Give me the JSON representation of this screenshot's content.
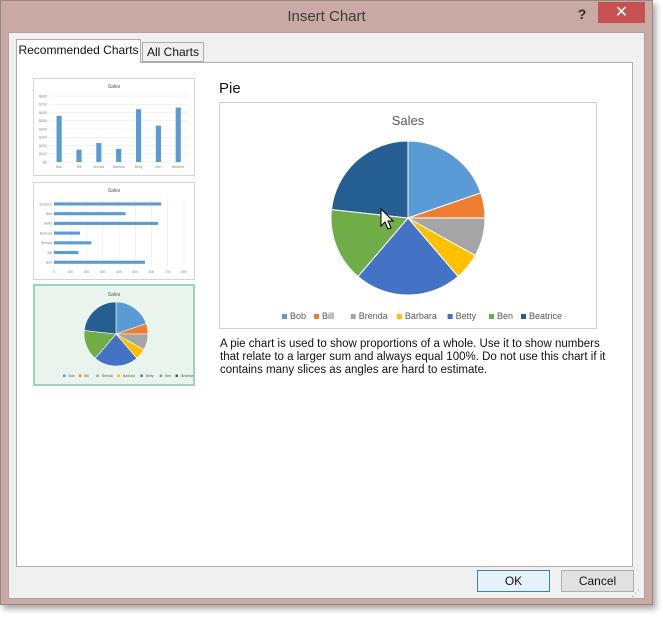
{
  "window": {
    "title": "Insert Chart",
    "help_label": "?",
    "close_label": "✕"
  },
  "tabs": [
    {
      "label": "Recommended Charts",
      "active": true
    },
    {
      "label": "All Charts",
      "active": false
    }
  ],
  "thumbnails": [
    {
      "kind": "column",
      "title": "Sales",
      "selected": false
    },
    {
      "kind": "bar",
      "title": "Sales",
      "selected": false
    },
    {
      "kind": "pie",
      "title": "Sales",
      "selected": true
    }
  ],
  "selected_chart": {
    "heading": "Pie",
    "description": "A pie chart is used to show proportions of a whole. Use it to show numbers that relate to a larger sum and always equal 100%. Do not use this chart if it contains many slices as angles are hard to estimate."
  },
  "chart_data": {
    "type": "pie",
    "title": "Sales",
    "categories": [
      "Bob",
      "Bill",
      "Brenda",
      "Barbara",
      "Betty",
      "Ben",
      "Beatrice"
    ],
    "values": [
      560,
      150,
      230,
      160,
      640,
      440,
      660
    ],
    "colors": [
      "#5b9bd5",
      "#ed7d31",
      "#a5a5a5",
      "#ffc000",
      "#4472c4",
      "#70ad47",
      "#255e91"
    ],
    "legend_position": "bottom"
  },
  "bar_thumb_axis": [
    "0",
    "100",
    "200",
    "300",
    "400",
    "500",
    "600",
    "700",
    "800"
  ],
  "column_thumb_axis": [
    "$800",
    "$700",
    "$600",
    "$500",
    "$400",
    "$300",
    "$200",
    "$100",
    "$0"
  ],
  "buttons": {
    "ok": "OK",
    "cancel": "Cancel"
  }
}
